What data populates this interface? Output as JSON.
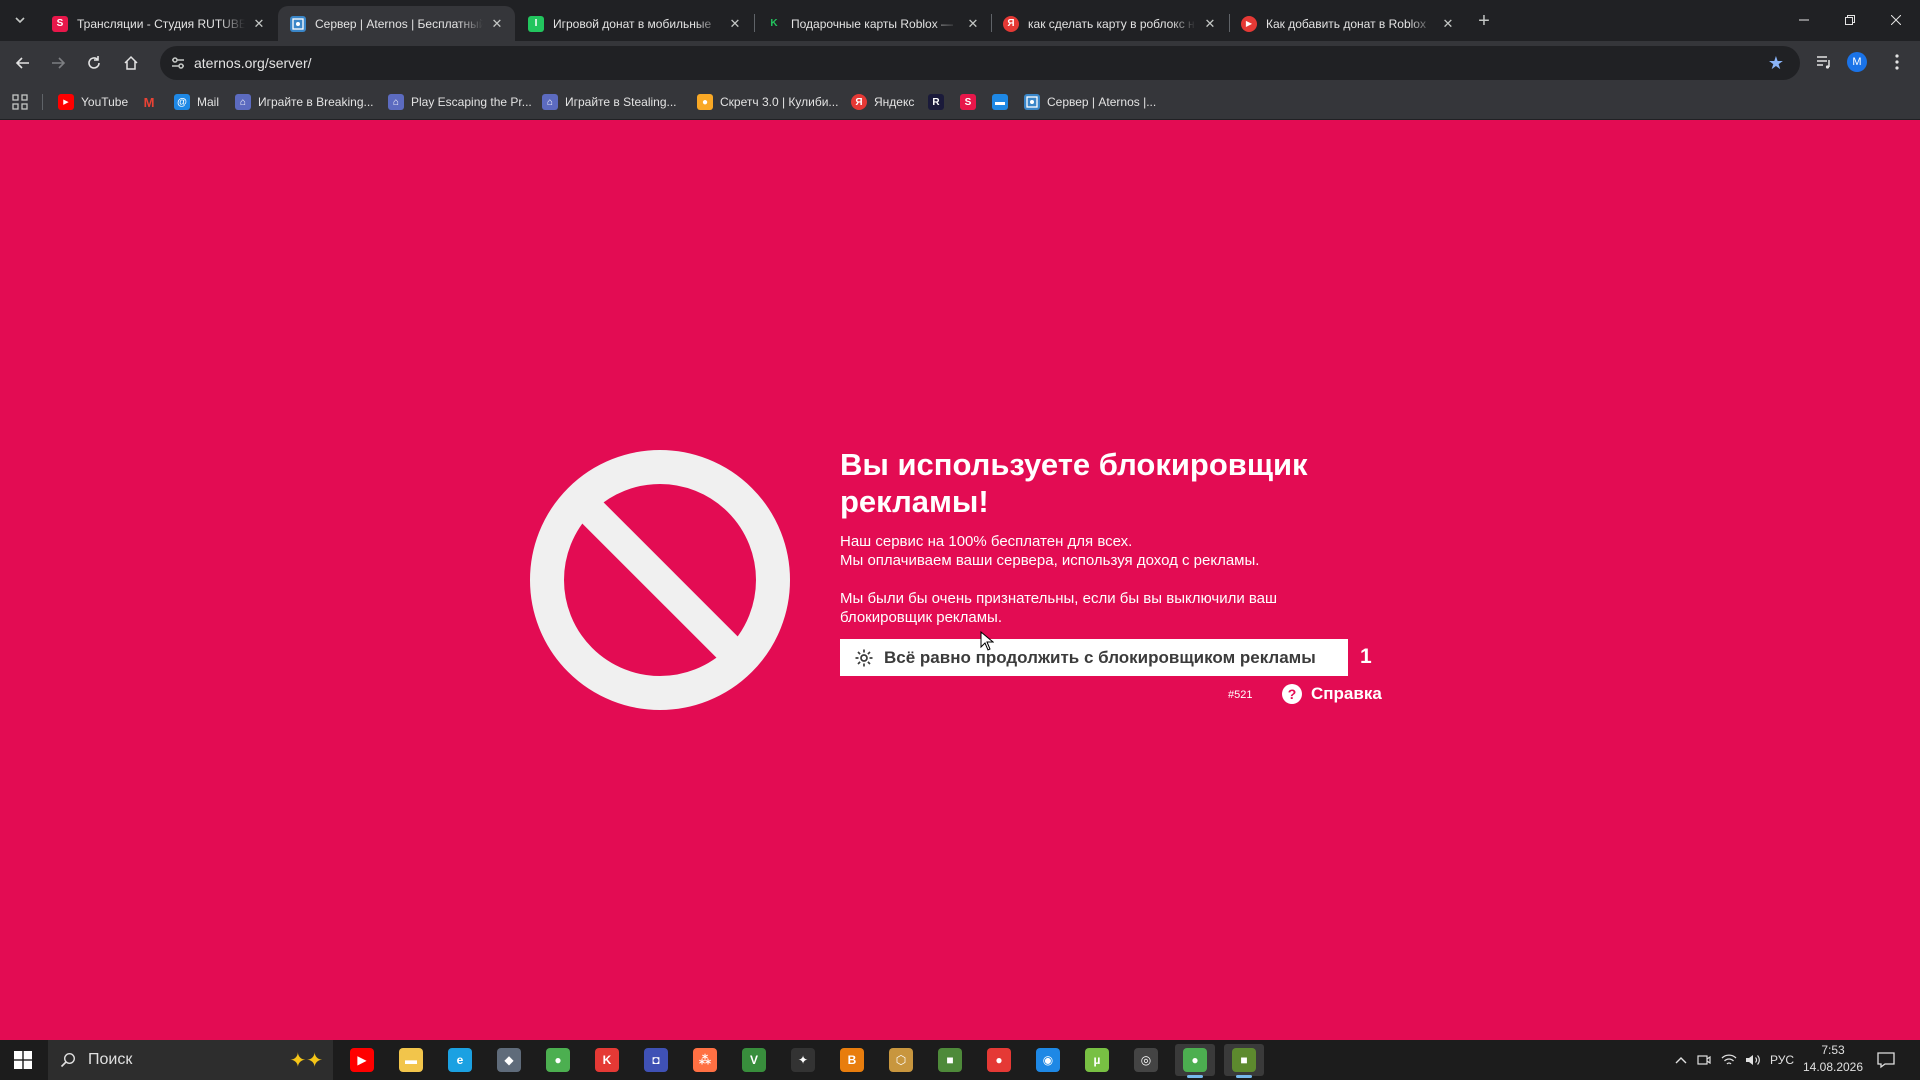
{
  "browser": {
    "tabs": [
      {
        "title": "Трансляции - Студия RUTUBE",
        "favicon_letter": "S",
        "favicon_color": "#e8174a",
        "active": false
      },
      {
        "title": "Сервер | Aternos | Бесплатный",
        "favicon_letter": "",
        "favicon_color": "#3a86c8",
        "active": true
      },
      {
        "title": "Игровой донат в мобильные",
        "favicon_letter": "I",
        "favicon_color": "#22c55e",
        "active": false
      },
      {
        "title": "Подарочные карты Roblox —",
        "favicon_letter": "K",
        "favicon_color": "#22c55e",
        "active": false
      },
      {
        "title": "как сделать карту в роблокс н",
        "favicon_letter": "Я",
        "favicon_color": "#e53935",
        "active": false
      },
      {
        "title": "Как добавить донат в Roblox",
        "favicon_letter": "▶",
        "favicon_color": "#e53935",
        "active": false
      }
    ],
    "url": "aternos.org/server/",
    "avatar_letter": "M",
    "bookmarks": [
      {
        "label": "YouTube",
        "icon": "youtube-icon",
        "color": "#ff0000",
        "letter": "▶"
      },
      {
        "label": "",
        "icon": "gmail-icon",
        "color": "#ea4335",
        "letter": "M"
      },
      {
        "label": "Mail",
        "icon": "mail-icon",
        "color": "#1e88e5",
        "letter": "@"
      },
      {
        "label": "Играйте в Breaking...",
        "icon": "gamepad-icon",
        "color": "#5c6bc0",
        "letter": "⌂"
      },
      {
        "label": "Play Escaping the Pr...",
        "icon": "gamepad-icon",
        "color": "#5c6bc0",
        "letter": "⌂"
      },
      {
        "label": "Играйте в Stealing...",
        "icon": "gamepad-icon",
        "color": "#5c6bc0",
        "letter": "⌂"
      },
      {
        "label": "Скретч 3.0 | Кулиби...",
        "icon": "scratch-cat-icon",
        "color": "#f9a825",
        "letter": "●"
      },
      {
        "label": "Яндекс",
        "icon": "yandex-icon",
        "color": "#e53935",
        "letter": "Я"
      },
      {
        "label": "",
        "icon": "rutube-icon",
        "color": "#1a1a3a",
        "letter": "R"
      },
      {
        "label": "",
        "icon": "studio-icon",
        "color": "#e8174a",
        "letter": "S"
      },
      {
        "label": "",
        "icon": "chat-icon",
        "color": "#1e88e5",
        "letter": "▬"
      },
      {
        "label": "Сервер | Aternos |...",
        "icon": "aternos-icon",
        "color": "#3a86c8",
        "letter": ""
      }
    ]
  },
  "page": {
    "title": "Вы используете блокировщик рекламы!",
    "para1_line1": "Наш сервис на 100% бесплатен для всех.",
    "para1_line2": "Мы оплачиваем ваши сервера, используя доход с рекламы.",
    "para2": "Мы были бы очень признательны, если бы вы выключили ваш блокировщик рекламы.",
    "continue_label": "Всё равно продолжить с блокировщиком рекламы",
    "counter": "1",
    "error_code": "#521",
    "help_label": "Справка",
    "help_icon_glyph": "?",
    "background_color": "#e30c53"
  },
  "taskbar": {
    "search_label": "Поиск",
    "apps": [
      {
        "name": "youtube-app-icon",
        "color": "#ff0000",
        "letter": "▶"
      },
      {
        "name": "file-explorer-icon",
        "color": "#f2c54b",
        "letter": "▬"
      },
      {
        "name": "edge-icon",
        "color": "#1ba1e2",
        "letter": "e"
      },
      {
        "name": "shield-app-icon",
        "color": "#5f6b7a",
        "letter": "◆"
      },
      {
        "name": "chrome-icon",
        "color": "#4caf50",
        "letter": "●"
      },
      {
        "name": "kaspersky-icon",
        "color": "#e53935",
        "letter": "K"
      },
      {
        "name": "blue-app-icon",
        "color": "#3f51b5",
        "letter": "◘"
      },
      {
        "name": "dots-app-icon",
        "color": "#ff7043",
        "letter": "⁂"
      },
      {
        "name": "v-app-icon",
        "color": "#388e3c",
        "letter": "V"
      },
      {
        "name": "dark-app-icon",
        "color": "#333333",
        "letter": "✦"
      },
      {
        "name": "blender-icon",
        "color": "#e87d0d",
        "letter": "B"
      },
      {
        "name": "hex-app-icon",
        "color": "#c8963e",
        "letter": "⬡"
      },
      {
        "name": "minecraft-icon",
        "color": "#4e8a3a",
        "letter": "■"
      },
      {
        "name": "record-icon",
        "color": "#e53935",
        "letter": "●"
      },
      {
        "name": "sphere-app-icon",
        "color": "#1e88e5",
        "letter": "◉"
      },
      {
        "name": "utorrent-icon",
        "color": "#78c043",
        "letter": "µ"
      },
      {
        "name": "obs-icon",
        "color": "#444444",
        "letter": "◎"
      },
      {
        "name": "chrome-active-icon",
        "color": "#4caf50",
        "letter": "●",
        "active": true
      },
      {
        "name": "minecraft-launcher-icon",
        "color": "#5d8a2e",
        "letter": "■",
        "active": true
      }
    ],
    "language": "РУС",
    "time": "7:53",
    "date": "14.08.2026"
  }
}
